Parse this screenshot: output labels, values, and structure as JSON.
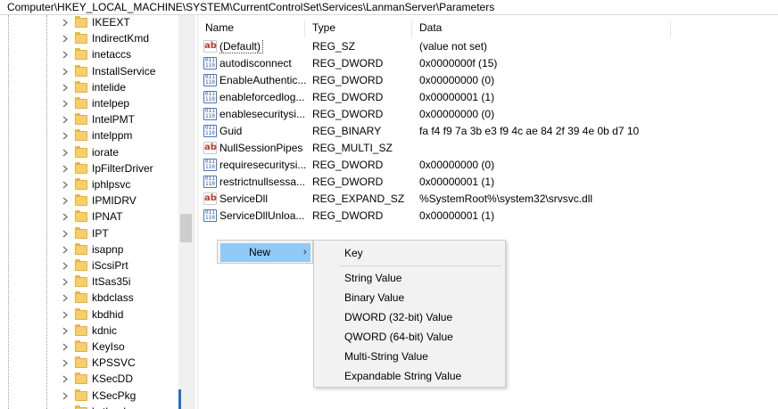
{
  "address": "Computer\\HKEY_LOCAL_MACHINE\\SYSTEM\\CurrentControlSet\\Services\\LanmanServer\\Parameters",
  "tree": {
    "items": [
      {
        "label": "IKEEXT"
      },
      {
        "label": "IndirectKmd"
      },
      {
        "label": "inetaccs"
      },
      {
        "label": "InstallService"
      },
      {
        "label": "intelide"
      },
      {
        "label": "intelpep"
      },
      {
        "label": "IntelPMT"
      },
      {
        "label": "intelppm"
      },
      {
        "label": "iorate"
      },
      {
        "label": "IpFilterDriver"
      },
      {
        "label": "iphlpsvc"
      },
      {
        "label": "IPMIDRV"
      },
      {
        "label": "IPNAT"
      },
      {
        "label": "IPT"
      },
      {
        "label": "isapnp"
      },
      {
        "label": "iScsiPrt"
      },
      {
        "label": "ItSas35i"
      },
      {
        "label": "kbdclass"
      },
      {
        "label": "kbdhid"
      },
      {
        "label": "kdnic"
      },
      {
        "label": "KeyIso"
      },
      {
        "label": "KPSSVC"
      },
      {
        "label": "KSecDD"
      },
      {
        "label": "KSecPkg"
      },
      {
        "label": "ksthunk"
      }
    ]
  },
  "list": {
    "headers": {
      "name": "Name",
      "type": "Type",
      "data": "Data"
    },
    "rows": [
      {
        "icon": "string-value-icon",
        "name": "(Default)",
        "type": "REG_SZ",
        "data": "(value not set)"
      },
      {
        "icon": "binary-value-icon",
        "name": "autodisconnect",
        "type": "REG_DWORD",
        "data": "0x0000000f (15)"
      },
      {
        "icon": "binary-value-icon",
        "name": "EnableAuthentic...",
        "type": "REG_DWORD",
        "data": "0x00000000 (0)"
      },
      {
        "icon": "binary-value-icon",
        "name": "enableforcedlog...",
        "type": "REG_DWORD",
        "data": "0x00000001 (1)"
      },
      {
        "icon": "binary-value-icon",
        "name": "enablesecuritysi...",
        "type": "REG_DWORD",
        "data": "0x00000000 (0)"
      },
      {
        "icon": "binary-value-icon",
        "name": "Guid",
        "type": "REG_BINARY",
        "data": "fa f4 f9 7a 3b e3 f9 4c ae 84 2f 39 4e 0b d7 10"
      },
      {
        "icon": "string-value-icon",
        "name": "NullSessionPipes",
        "type": "REG_MULTI_SZ",
        "data": ""
      },
      {
        "icon": "binary-value-icon",
        "name": "requiresecuritysi...",
        "type": "REG_DWORD",
        "data": "0x00000000 (0)"
      },
      {
        "icon": "binary-value-icon",
        "name": "restrictnullsessa...",
        "type": "REG_DWORD",
        "data": "0x00000001 (1)"
      },
      {
        "icon": "string-value-icon",
        "name": "ServiceDll",
        "type": "REG_EXPAND_SZ",
        "data": "%SystemRoot%\\system32\\srvsvc.dll"
      },
      {
        "icon": "binary-value-icon",
        "name": "ServiceDllUnloa...",
        "type": "REG_DWORD",
        "data": "0x00000001 (1)"
      }
    ]
  },
  "context_menu": {
    "new_label": "New",
    "new_arrow": "›",
    "submenu": {
      "key": "Key",
      "items": [
        "String Value",
        "Binary Value",
        "DWORD (32-bit) Value",
        "QWORD (64-bit) Value",
        "Multi-String Value",
        "Expandable String Value"
      ]
    }
  }
}
